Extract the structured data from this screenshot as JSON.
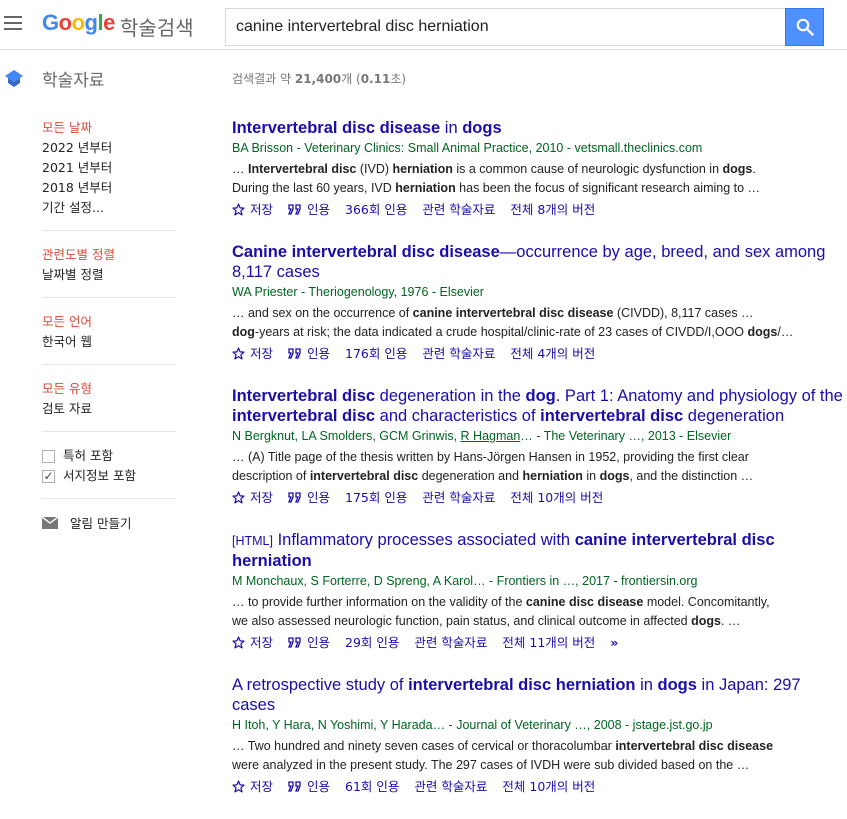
{
  "header": {
    "logo": {
      "g1": "G",
      "o1": "o",
      "o2": "o",
      "g2": "g",
      "l": "l",
      "e": "e"
    },
    "logo_suffix": "학술검색",
    "search_value": "canine intervertebral disc herniation",
    "menu_icon": "hamburger-menu-icon",
    "search_icon": "search-icon",
    "accent_color": "#4d90fe"
  },
  "subbar": {
    "title": "학술자료",
    "icon": "scholar-cap-icon",
    "count_prefix": "검색결과 약 ",
    "count_value": "21,400",
    "count_mid": "개 (",
    "count_time": "0.11",
    "count_suffix": "초)"
  },
  "sidebar": {
    "date": {
      "head": "모든 날짜",
      "items": [
        "2022 년부터",
        "2021 년부터",
        "2018 년부터",
        "기간 설정..."
      ]
    },
    "sort": {
      "head": "관련도별 정렬",
      "items": [
        "날짜별 정렬"
      ]
    },
    "lang": {
      "head": "모든 언어",
      "items": [
        "한국어 웹"
      ]
    },
    "type": {
      "head": "모든 유형",
      "items": [
        "검토 자료"
      ]
    },
    "checks": [
      {
        "label": "특허 포함",
        "checked": false
      },
      {
        "label": "서지정보 포함",
        "checked": true
      }
    ],
    "alert_label": "알림 만들기",
    "alert_icon": "mail-icon"
  },
  "results": [
    {
      "title_parts": [
        [
          "b",
          "Intervertebral disc disease"
        ],
        [
          "t",
          " in "
        ],
        [
          "b",
          "dogs"
        ]
      ],
      "meta": "BA Brisson - Veterinary Clinics: Small Animal Practice, 2010 - vetsmall.theclinics.com",
      "snippet_parts": [
        [
          "t",
          "… "
        ],
        [
          "b",
          "Intervertebral disc"
        ],
        [
          "t",
          " (IVD) "
        ],
        [
          "b",
          "herniation"
        ],
        [
          "t",
          " is a common cause of neurologic dysfunction in "
        ],
        [
          "b",
          "dogs"
        ],
        [
          "t",
          ".\nDuring the last 60 years, IVD "
        ],
        [
          "b",
          "herniation"
        ],
        [
          "t",
          " has been the focus of significant research aiming to …"
        ]
      ],
      "actions": {
        "save": "저장",
        "cite": "인용",
        "cited_by": "366회 인용",
        "related": "관련 학술자료",
        "versions": "전체 8개의 버전"
      }
    },
    {
      "title_parts": [
        [
          "b",
          "Canine intervertebral disc disease"
        ],
        [
          "t",
          "—occurrence by age, breed, and sex among 8,117 cases"
        ]
      ],
      "meta": "WA Priester - Theriogenology, 1976 - Elsevier",
      "snippet_parts": [
        [
          "t",
          "… and sex on the occurrence of "
        ],
        [
          "b",
          "canine intervertebral disc disease"
        ],
        [
          "t",
          " (CIVDD), 8,117 cases …\n"
        ],
        [
          "b",
          "dog"
        ],
        [
          "t",
          "-years at risk; the data indicated a crude hospital/clinic-rate of 23 cases of CIVDD/I,OOO "
        ],
        [
          "b",
          "dogs"
        ],
        [
          "t",
          "/…"
        ]
      ],
      "actions": {
        "save": "저장",
        "cite": "인용",
        "cited_by": "176회 인용",
        "related": "관련 학술자료",
        "versions": "전체 4개의 버전"
      }
    },
    {
      "title_parts": [
        [
          "b",
          "Intervertebral disc"
        ],
        [
          "t",
          " degeneration in the "
        ],
        [
          "b",
          "dog"
        ],
        [
          "t",
          ". Part 1: Anatomy and physiology of the "
        ],
        [
          "b",
          "intervertebral disc"
        ],
        [
          "t",
          " and characteristics of "
        ],
        [
          "b",
          "intervertebral disc"
        ],
        [
          "t",
          " degeneration"
        ]
      ],
      "meta_parts": [
        [
          "t",
          "N Bergknut, LA Smolders, GCM Grinwis, "
        ],
        [
          "u",
          "R Hagman"
        ],
        [
          "t",
          "… - The Veterinary …, 2013 - Elsevier"
        ]
      ],
      "snippet_parts": [
        [
          "t",
          "… (A) Title page of the thesis written by Hans-Jörgen Hansen in 1952, providing the first clear\ndescription of "
        ],
        [
          "b",
          "intervertebral disc"
        ],
        [
          "t",
          " degeneration and "
        ],
        [
          "b",
          "herniation"
        ],
        [
          "t",
          " in "
        ],
        [
          "b",
          "dogs"
        ],
        [
          "t",
          ", and the distinction …"
        ]
      ],
      "actions": {
        "save": "저장",
        "cite": "인용",
        "cited_by": "175회 인용",
        "related": "관련 학술자료",
        "versions": "전체 10개의 버전"
      }
    },
    {
      "tag": "[HTML]",
      "title_parts": [
        [
          "t",
          " Inflammatory processes associated with "
        ],
        [
          "b",
          "canine intervertebral disc herniation"
        ]
      ],
      "meta": "M Monchaux, S Forterre, D Spreng, A Karol… - Frontiers in …, 2017 - frontiersin.org",
      "snippet_parts": [
        [
          "t",
          "… to provide further information on the validity of the "
        ],
        [
          "b",
          "canine disc disease"
        ],
        [
          "t",
          " model. Concomitantly,\nwe also assessed neurologic function, pain status, and clinical outcome in affected "
        ],
        [
          "b",
          "dogs"
        ],
        [
          "t",
          ". …"
        ]
      ],
      "actions": {
        "save": "저장",
        "cite": "인용",
        "cited_by": "29회 인용",
        "related": "관련 학술자료",
        "versions": "전체 11개의 버전",
        "more": "»"
      }
    },
    {
      "title_parts": [
        [
          "t",
          "A retrospective study of "
        ],
        [
          "b",
          "intervertebral disc herniation"
        ],
        [
          "t",
          " in "
        ],
        [
          "b",
          "dogs"
        ],
        [
          "t",
          " in Japan: 297 cases"
        ]
      ],
      "meta": "H Itoh, Y Hara, N Yoshimi, Y Harada… - Journal of Veterinary …, 2008 - jstage.jst.go.jp",
      "snippet_parts": [
        [
          "t",
          "… Two hundred and ninety seven cases of cervical or thoracolumbar "
        ],
        [
          "b",
          "intervertebral disc disease"
        ],
        [
          "t",
          "\nwere analyzed in the present study. The 297 cases of IVDH were sub divided based on the …"
        ]
      ],
      "actions": {
        "save": "저장",
        "cite": "인용",
        "cited_by": "61회 인용",
        "related": "관련 학술자료",
        "versions": "전체 10개의 버전"
      }
    }
  ]
}
